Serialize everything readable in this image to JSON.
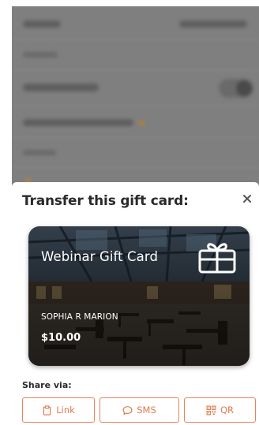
{
  "sheet": {
    "title": "Transfer this gift card:",
    "close_icon": "close-icon"
  },
  "gift_card": {
    "name": "Webinar Gift Card",
    "holder": "SOPHIA R MARION",
    "amount": "$10.00",
    "icon": "gift-icon"
  },
  "share": {
    "label": "Share via:",
    "buttons": [
      {
        "label": "Link",
        "icon": "clipboard-icon"
      },
      {
        "label": "SMS",
        "icon": "chat-bubble-icon"
      },
      {
        "label": "QR",
        "icon": "qr-code-icon"
      }
    ]
  },
  "colors": {
    "accent": "#e07a4e",
    "backdrop": "#7f7f7f",
    "title": "#2a2a2a"
  }
}
